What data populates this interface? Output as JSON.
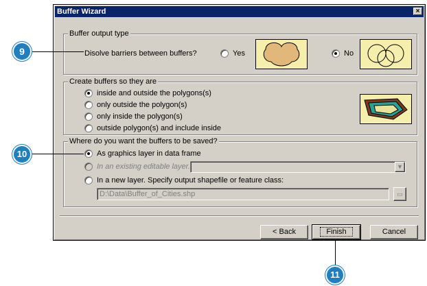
{
  "window": {
    "title": "Buffer Wizard",
    "close_glyph": "×"
  },
  "output_type": {
    "legend": "Buffer output type",
    "question": "Disolve barriers between buffers?",
    "yes_label": "Yes",
    "no_label": "No",
    "selected": "No"
  },
  "create_buffers": {
    "legend": "Create buffers so they are",
    "options": [
      "inside and outside the polygons(s)",
      "only outside the polygon(s)",
      "only inside the polygon(s)",
      "outside polygon(s) and include inside"
    ],
    "selected": "inside and outside the polygons(s)"
  },
  "save_location": {
    "legend": "Where do you want the buffers to be saved?",
    "opt_graphics": "As graphics layer in data frame",
    "opt_existing": "In an existing editable layer.",
    "opt_new": "In a new layer.  Specify output shapefile or feature class:",
    "path_value": "D:\\Data\\Buffer_of_Cities.shp",
    "selected": "As graphics layer in data frame"
  },
  "buttons": {
    "back": "< Back",
    "finish": "Finish",
    "cancel": "Cancel"
  },
  "callouts": {
    "step9": "9",
    "step10": "10",
    "step11": "11"
  },
  "colors": {
    "title_bar": "#0a246a",
    "dialog_face": "#d4d0c8",
    "callout": "#1f7fbf",
    "preview_bg": "#f6eeab",
    "buffer_fill": "#e2b77a"
  }
}
